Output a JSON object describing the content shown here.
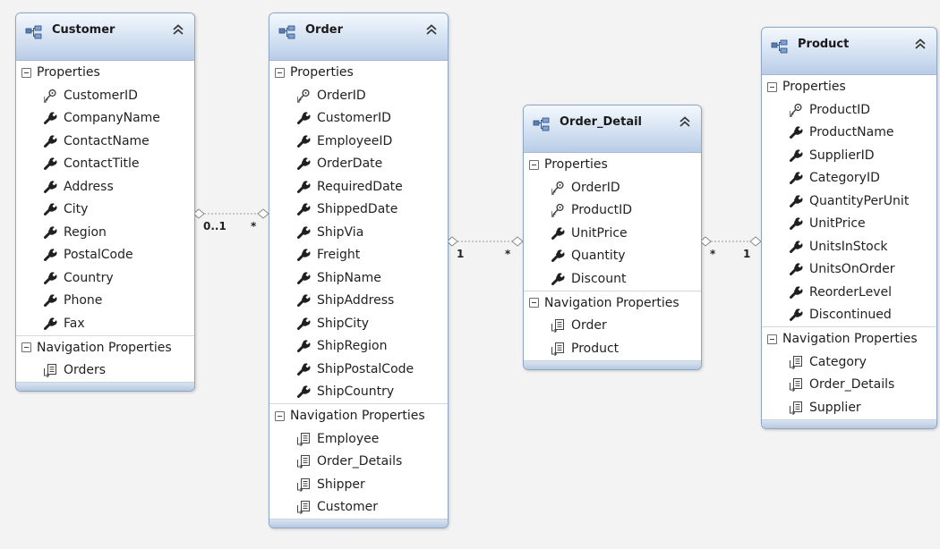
{
  "entities": [
    {
      "key": "customer",
      "title": "Customer",
      "properties_label": "Properties",
      "properties": [
        {
          "name": "CustomerID",
          "key": true
        },
        {
          "name": "CompanyName",
          "key": false
        },
        {
          "name": "ContactName",
          "key": false
        },
        {
          "name": "ContactTitle",
          "key": false
        },
        {
          "name": "Address",
          "key": false
        },
        {
          "name": "City",
          "key": false
        },
        {
          "name": "Region",
          "key": false
        },
        {
          "name": "PostalCode",
          "key": false
        },
        {
          "name": "Country",
          "key": false
        },
        {
          "name": "Phone",
          "key": false
        },
        {
          "name": "Fax",
          "key": false
        }
      ],
      "navigation_label": "Navigation Properties",
      "navigation": [
        "Orders"
      ]
    },
    {
      "key": "order",
      "title": "Order",
      "properties_label": "Properties",
      "properties": [
        {
          "name": "OrderID",
          "key": true
        },
        {
          "name": "CustomerID",
          "key": false
        },
        {
          "name": "EmployeeID",
          "key": false
        },
        {
          "name": "OrderDate",
          "key": false
        },
        {
          "name": "RequiredDate",
          "key": false
        },
        {
          "name": "ShippedDate",
          "key": false
        },
        {
          "name": "ShipVia",
          "key": false
        },
        {
          "name": "Freight",
          "key": false
        },
        {
          "name": "ShipName",
          "key": false
        },
        {
          "name": "ShipAddress",
          "key": false
        },
        {
          "name": "ShipCity",
          "key": false
        },
        {
          "name": "ShipRegion",
          "key": false
        },
        {
          "name": "ShipPostalCode",
          "key": false
        },
        {
          "name": "ShipCountry",
          "key": false
        }
      ],
      "navigation_label": "Navigation Properties",
      "navigation": [
        "Employee",
        "Order_Details",
        "Shipper",
        "Customer"
      ]
    },
    {
      "key": "order_detail",
      "title": "Order_Detail",
      "properties_label": "Properties",
      "properties": [
        {
          "name": "OrderID",
          "key": true
        },
        {
          "name": "ProductID",
          "key": true
        },
        {
          "name": "UnitPrice",
          "key": false
        },
        {
          "name": "Quantity",
          "key": false
        },
        {
          "name": "Discount",
          "key": false
        }
      ],
      "navigation_label": "Navigation Properties",
      "navigation": [
        "Order",
        "Product"
      ]
    },
    {
      "key": "product",
      "title": "Product",
      "properties_label": "Properties",
      "properties": [
        {
          "name": "ProductID",
          "key": true
        },
        {
          "name": "ProductName",
          "key": false
        },
        {
          "name": "SupplierID",
          "key": false
        },
        {
          "name": "CategoryID",
          "key": false
        },
        {
          "name": "QuantityPerUnit",
          "key": false
        },
        {
          "name": "UnitPrice",
          "key": false
        },
        {
          "name": "UnitsInStock",
          "key": false
        },
        {
          "name": "UnitsOnOrder",
          "key": false
        },
        {
          "name": "ReorderLevel",
          "key": false
        },
        {
          "name": "Discontinued",
          "key": false
        }
      ],
      "navigation_label": "Navigation Properties",
      "navigation": [
        "Category",
        "Order_Details",
        "Supplier"
      ]
    }
  ],
  "associations": [
    {
      "from": "customer",
      "to": "order",
      "from_mult": "0..1",
      "to_mult": "*"
    },
    {
      "from": "order",
      "to": "order_detail",
      "from_mult": "1",
      "to_mult": "*"
    },
    {
      "from": "order_detail",
      "to": "product",
      "from_mult": "*",
      "to_mult": "1"
    }
  ],
  "colors": {
    "header_top": "#f4f8fd",
    "header_bottom": "#b9cce6",
    "border": "#8fa7c6",
    "connector": "#9a9a9a"
  },
  "icons": {
    "entity": "entity-type-icon",
    "collapse": "collapse-chevrons-icon",
    "key_property": "key-property-icon",
    "scalar_property": "wrench-property-icon",
    "navigation_property": "navigation-property-icon"
  }
}
